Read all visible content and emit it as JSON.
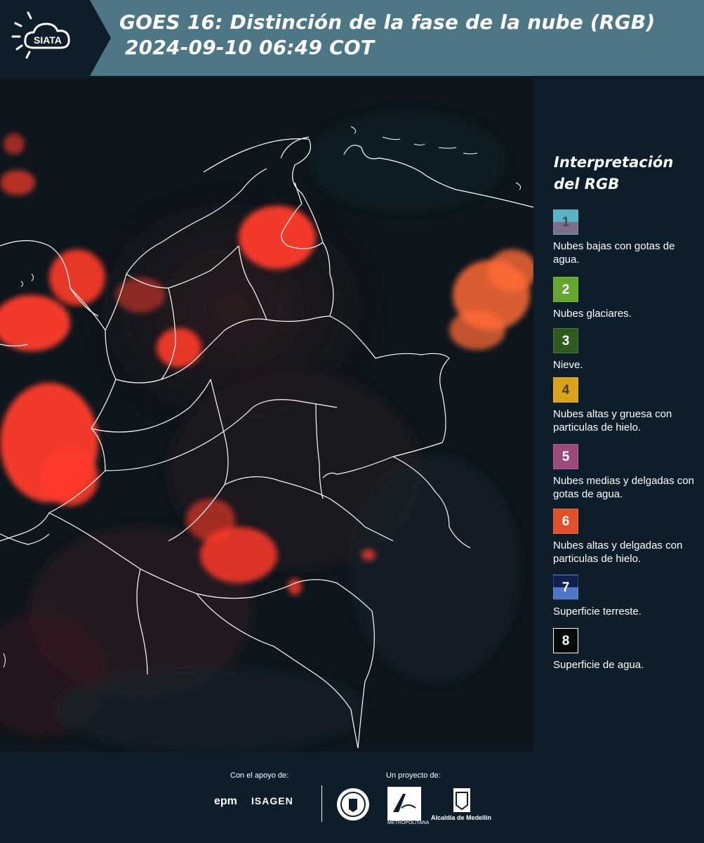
{
  "header": {
    "logo_text": "SIATA",
    "title_line1": "GOES 16: Distinción de la fase de la nube (RGB)",
    "title_line2": "2024-09-10 06:49 COT"
  },
  "legend": {
    "title": "Interpretación del RGB",
    "items": [
      {
        "num": "1",
        "label": "Nubes bajas con gotas de agua.",
        "top_color": "#58b3c4",
        "bottom_color": "#7b6f8d",
        "num_color": "#4a4a55"
      },
      {
        "num": "2",
        "label": "Nubes glaciares.",
        "top_color": "#64a62f",
        "bottom_color": "#64a62f",
        "num_color": "#ffffff"
      },
      {
        "num": "3",
        "label": "Nieve.",
        "top_color": "#2f5b1d",
        "bottom_color": "#2f5b1d",
        "num_color": "#ffffff"
      },
      {
        "num": "4",
        "label": "Nubes altas y gruesa con particulas de hielo.",
        "top_color": "#d9a31b",
        "bottom_color": "#d9a31b",
        "num_color": "#4a3a10"
      },
      {
        "num": "5",
        "label": "Nubes medias y delgadas con gotas de agua.",
        "top_color": "#9c4a7b",
        "bottom_color": "#9c4a7b",
        "num_color": "#ffffff"
      },
      {
        "num": "6",
        "label": "Nubes altas y delgadas con particulas de hielo.",
        "top_color": "#e2502a",
        "bottom_color": "#e2502a",
        "num_color": "#ffffff"
      },
      {
        "num": "7",
        "label": "Superficie terreste.",
        "top_color": "#10214f",
        "bottom_color": "#4f75c7",
        "num_color": "#ffffff"
      },
      {
        "num": "8",
        "label": "Superficie de agua.",
        "top_color": "#060a08",
        "bottom_color": "#060a08",
        "num_color": "#ffffff"
      }
    ]
  },
  "footer": {
    "support_label": "Con el apoyo de:",
    "project_label": "Un proyecto de:",
    "sponsor1": "epm",
    "sponsor2": "ISAGEN",
    "area_text": "METROPOLITANA",
    "alcaldia": "Alcaldía de Medellín"
  },
  "colors": {
    "header_bg": "#4e7785",
    "panel_bg": "#0d1d2a",
    "cloud_red": "#ff3b2a"
  }
}
